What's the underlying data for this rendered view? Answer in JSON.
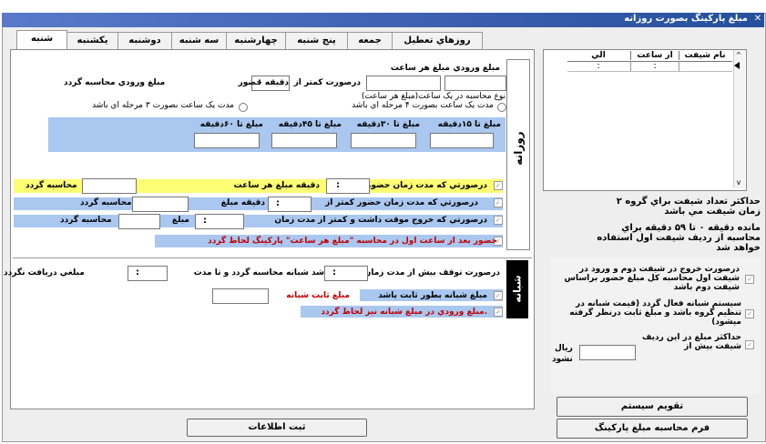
{
  "window": {
    "title": "مبلغ پارکینگ بصورت روزانه"
  },
  "tabs": [
    "روزهاي تعطيل",
    "جمعه",
    "پنج شنبه",
    "چهارشنبه",
    "سه شنبه",
    "دوشنبه",
    "يکشنبه",
    "شنبه"
  ],
  "daily": {
    "side_label": "روزانه",
    "entry_fee": "مبلغ ورودي",
    "hourly_fee": "مبلغ هر ساعت",
    "if_less_than": "درصورت کمتر از",
    "minute_presence": "دقيقه حضور",
    "entry_calc": "مبلغ ورودي محاسبه گردد",
    "calc_type": "نوع محاسبه در يک ساعت(مبلغ هر ساعت)",
    "radio_4_steps": "مدت يک ساعت بصورت ۴ مرحله اي باشد",
    "radio_3_steps": "مدت يک ساعت بصورت ۳ مرحله اي باشد",
    "up_to_15": "مبلغ تا ۱۵دقيقه",
    "up_to_30": "مبلغ تا ۳۰دقيقه",
    "up_to_45": "مبلغ تا ۴۵دقيقه",
    "up_to_60": "مبلغ تا ۶۰دقيقه",
    "row1_a": "درصورتي که مدت زمان حضور بيشتر از",
    "row1_b": "دقيقه مبلغ هر ساعت",
    "row1_c": "محاسبه گردد",
    "row2_a": "درصورتي که مدت زمان حضور کمتر از",
    "row2_b": "دقيقه مبلغ",
    "row2_c": "محاسبه گردد",
    "row3_a": "درصورتي که خروج موقت داشت و کمتر از مدت زمان",
    "row3_b": "مبلغ",
    "row3_c": "محاسبه گردد",
    "row4": "حضور بعد از ساعت اول در محاسبه \"مبلغ هر ساعت\" پارکينگ لحاظ گردد"
  },
  "night": {
    "side_label": "شبانه",
    "row1_a": "درصورت توقف بيش از مدت زمان",
    "row1_b": "شد شبانه محاسبه گردد و تا مدت",
    "row1_c": "مبلغي دريافت نگردد",
    "fixed_check": "مبلغ شبانه بطور ثابت باشد",
    "fixed_amount": "مبلغ ثابت شبانه",
    "entry_check": "مبلغ ورودي در مبلغ شبانه نيز لحاظ گردد."
  },
  "shift_grid": {
    "headers": [
      "نام شيفت",
      "از ساعت",
      "الي"
    ],
    "rows": [
      {
        "name": "",
        "from": ":",
        "to": ":"
      }
    ]
  },
  "right": {
    "max_shift": "حداکثر تعداد شيفت براي گروه ۲ زمان شيفت مي باشد",
    "remaining": "مانده دقيقه ۰ تا ۵۹ دقيقه براي محاسبه از رديف شيفت اول استفاده خواهد شد",
    "exit_check": "درصورت خروج در شيفت دوم و ورود در شيفت اول محاسبه کل مبلغ حضور براساس شيفت دوم باشد",
    "night_system_check": "سيستم شبانه فعال گردد (قيمت شبانه در تنظيم گروه باشد و مبلغ ثابت درنظر گرفته ميشود)",
    "max_amount_check": "حداکثر مبلغ در اين رديف شيفت بيش از",
    "rial": "ريال",
    "not_be": "نشود"
  },
  "buttons": {
    "calendar": "تقويم سيستم",
    "form_calc": "فرم محاسبه مبلغ پارکينگ",
    "save": "ثبت اطلاعات"
  },
  "colors": {
    "title_bar": "#3a63b5",
    "blue_band": "#a9c7ef",
    "yellow_band": "#fdfd74",
    "red_text": "#c00000"
  }
}
